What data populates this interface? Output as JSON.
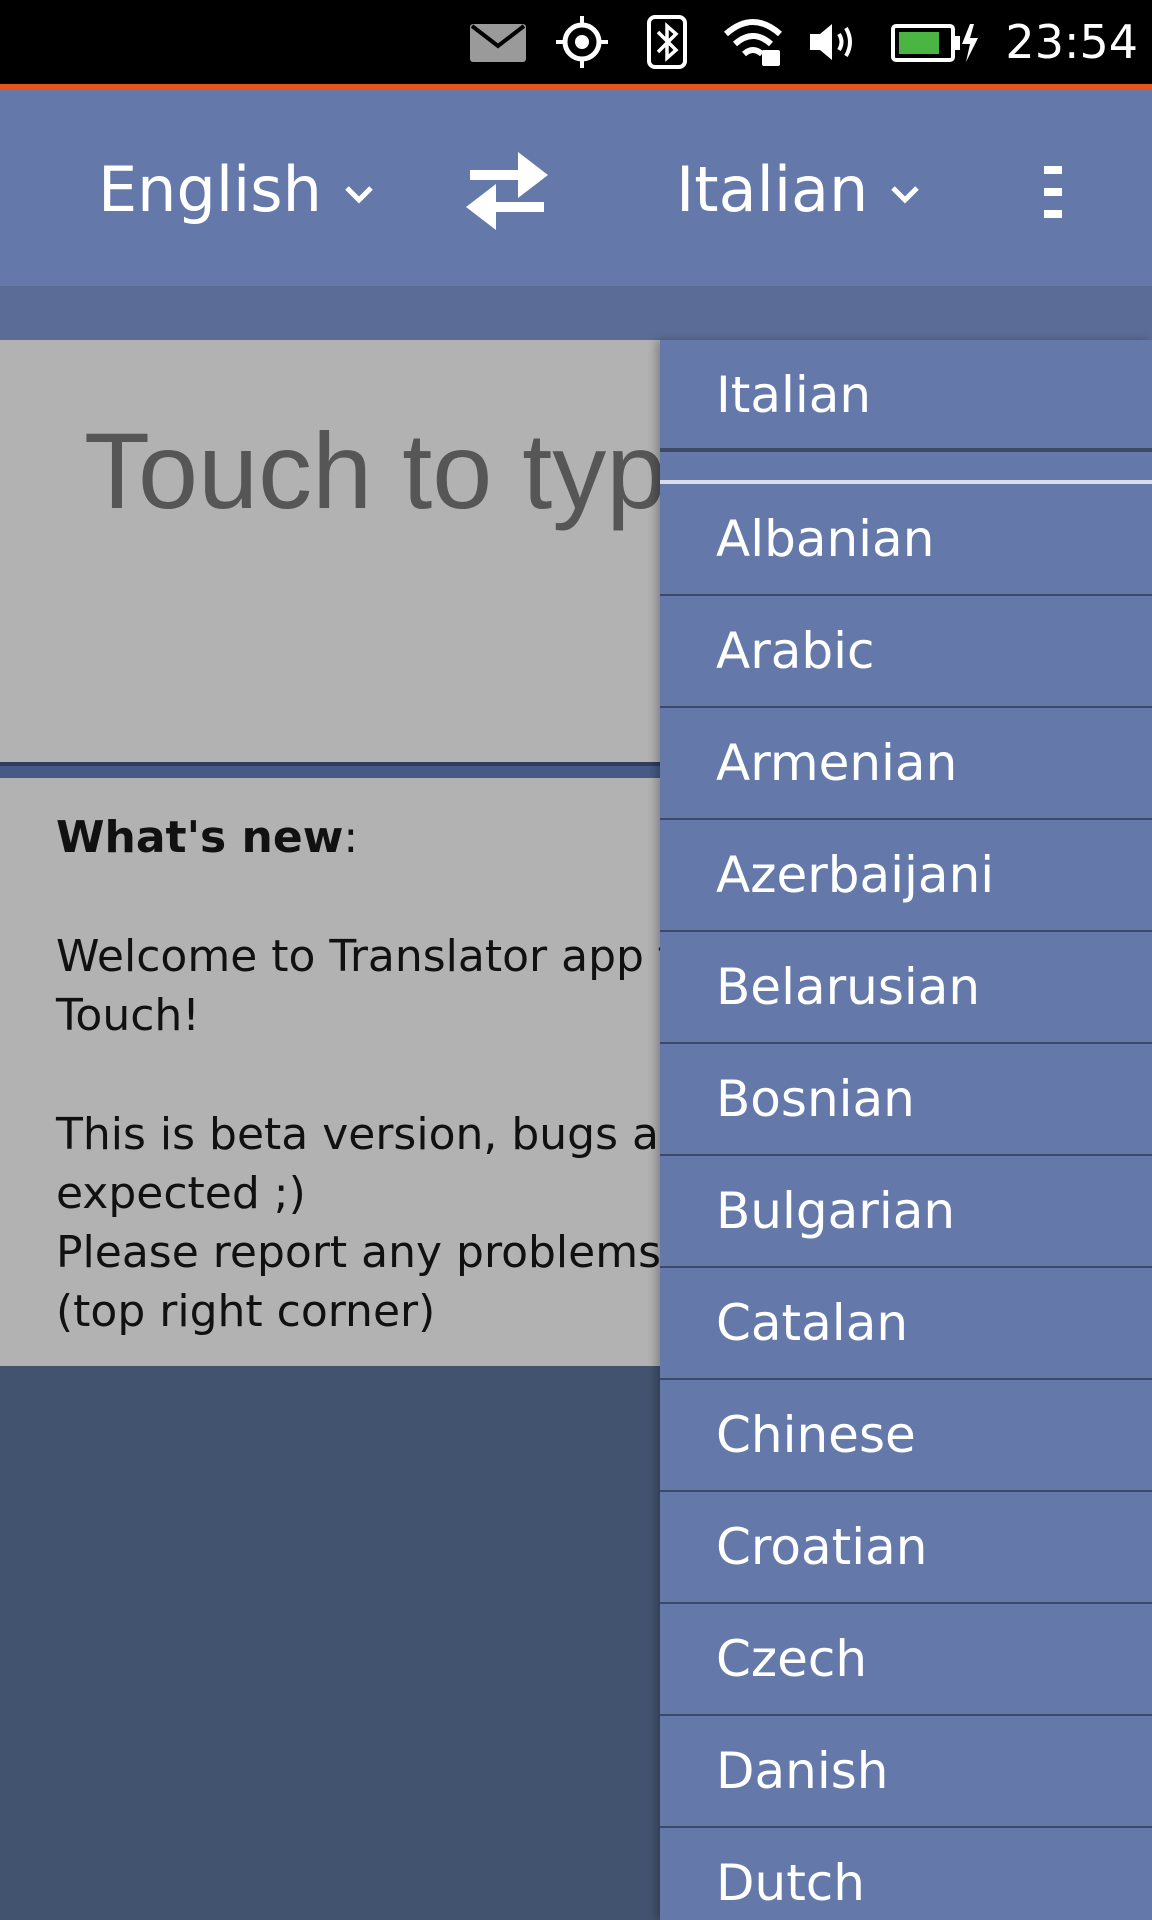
{
  "status_bar": {
    "time": "23:54",
    "icons": [
      "mail-icon",
      "location-icon",
      "bluetooth-icon",
      "wifi-icon",
      "volume-icon",
      "battery-charging-icon"
    ],
    "accent_color": "#e4541c"
  },
  "header": {
    "source_language": "English",
    "target_language": "Italian",
    "swap_icon": "swap-arrows-icon",
    "menu_icon": "overflow-menu-icon",
    "background": "#6479aa"
  },
  "input": {
    "placeholder": "Touch to type"
  },
  "whats_new": {
    "title": "What's new",
    "title_suffix": ":",
    "lines": [
      "Welcome to Translator app for Ubuntu",
      "Touch!",
      "This is beta version, bugs are",
      "expected ;)",
      "Please report any problems",
      "(top right corner)"
    ]
  },
  "language_dropdown": {
    "selected": "Italian",
    "items": [
      "Albanian",
      "Arabic",
      "Armenian",
      "Azerbaijani",
      "Belarusian",
      "Bosnian",
      "Bulgarian",
      "Catalan",
      "Chinese",
      "Croatian",
      "Czech",
      "Danish",
      "Dutch"
    ]
  }
}
